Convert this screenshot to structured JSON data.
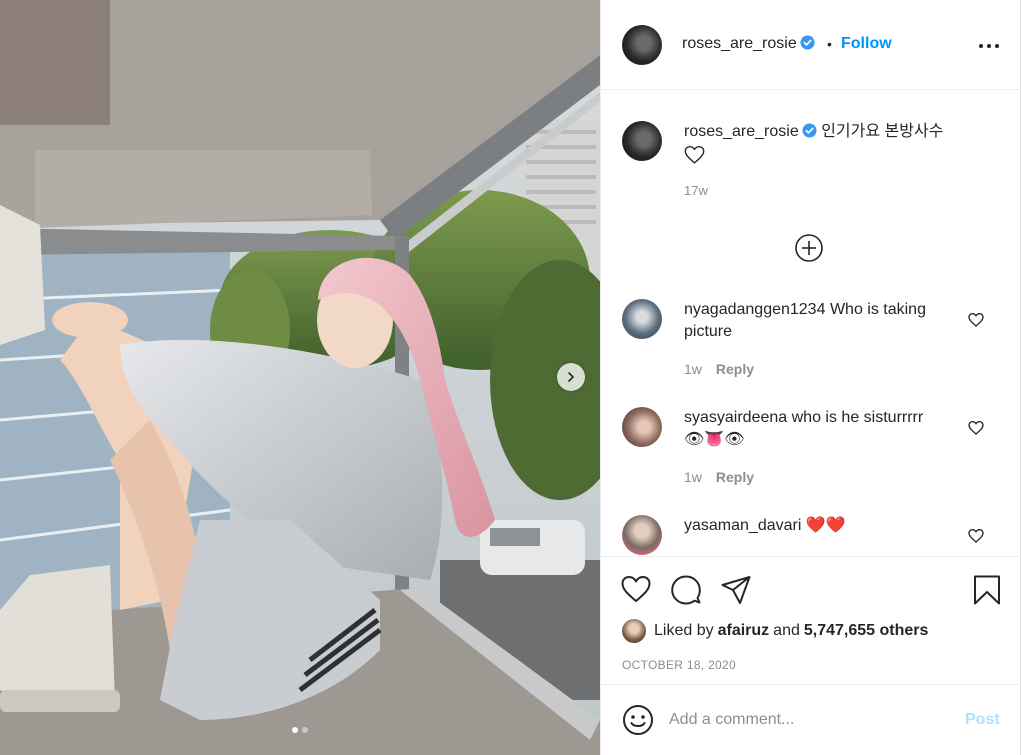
{
  "post": {
    "username": "roses_are_rosie",
    "separator": "•",
    "follow_label": "Follow"
  },
  "caption": {
    "username": "roses_are_rosie",
    "text": "인기가요 본방사수",
    "time": "17w"
  },
  "comments": [
    {
      "username": "nyagadanggen1234",
      "text": "Who is taking picture",
      "time": "1w",
      "reply_label": "Reply"
    },
    {
      "username": "syasyairdeena",
      "text": "who is he sisturrrrr",
      "emoji": "👁👅👁",
      "time": "1w",
      "reply_label": "Reply"
    },
    {
      "username": "yasaman_davari",
      "text": "❤️❤️"
    }
  ],
  "likes": {
    "prefix": "Liked by",
    "user": "afairuz",
    "middle": "and",
    "others": "5,747,655 others"
  },
  "date": "OCTOBER 18, 2020",
  "comment_box": {
    "placeholder": "Add a comment...",
    "post_label": "Post"
  },
  "colors": {
    "follow": "#0095f6",
    "verified": "#3897f0",
    "post_disabled": "#b2dffc",
    "secondary_text": "#8e8e8e"
  },
  "icons": [
    "verified-badge-icon",
    "more-options-icon",
    "plus-circle-icon",
    "heart-icon",
    "comment-icon",
    "share-icon",
    "bookmark-icon",
    "emoji-icon",
    "chevron-right-icon"
  ],
  "carousel": {
    "slide_count": 2,
    "active_index": 0
  }
}
